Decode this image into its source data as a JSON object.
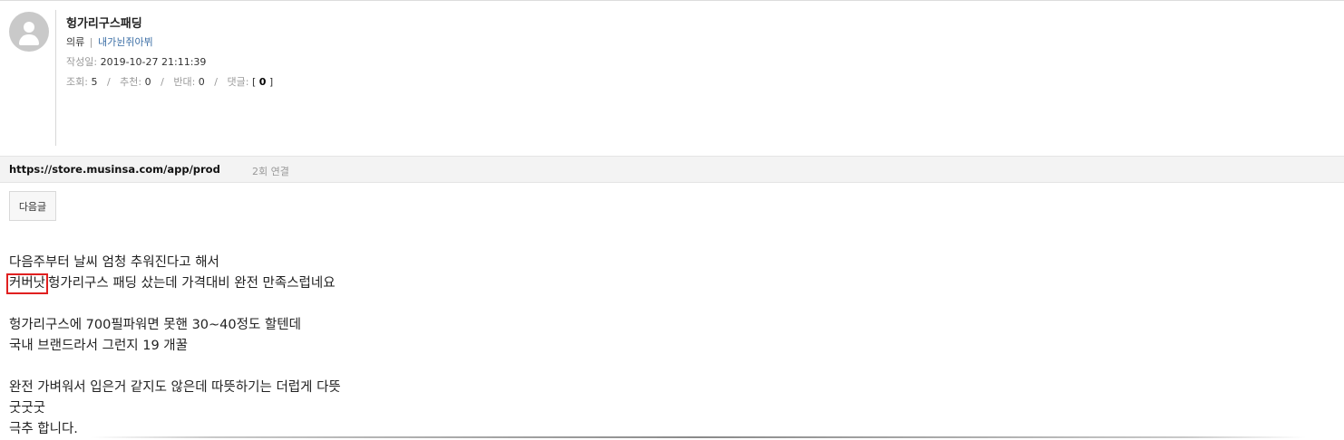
{
  "post": {
    "title": "헝가리구스패딩",
    "category": "의류",
    "category_separator": "|",
    "author": "내가뉜쥐아뷔",
    "date_label": "작성일:",
    "date_value": "2019-10-27 21:11:39",
    "stats": {
      "views_label": "조회:",
      "views_value": "5",
      "recommend_label": "추천:",
      "recommend_value": "0",
      "oppose_label": "반대:",
      "oppose_value": "0",
      "comments_label": "댓글:",
      "comments_open": "[",
      "comments_value": "0",
      "comments_close": "]",
      "separator": "/"
    }
  },
  "link_bar": {
    "url": "https://store.musinsa.com/app/product/",
    "count": "2회 연결"
  },
  "nav": {
    "next_label": "다음글"
  },
  "content": {
    "line1": "다음주부터 날씨 엄청 추워진다고 해서",
    "line2_boxed": "커버낫",
    "line2_rest": "헝가리구스 패딩 샀는데 가격대비 완전 만족스럽네요",
    "line3": "헝가리구스에 700필파워면 못핸 30~40정도 할텐데",
    "line4": "국내 브랜드라서 그런지 19 개꿀",
    "line5": "완전 가벼워서 입은거 같지도 않은데 따뜻하기는 더럽게 다뜻",
    "line6": "굿굿굿",
    "line7": "극추 합니다."
  },
  "colors": {
    "highlight_box": "#e02020",
    "author_link": "#3b6ea5"
  },
  "icons": {
    "avatar": "default-user-avatar-icon"
  }
}
